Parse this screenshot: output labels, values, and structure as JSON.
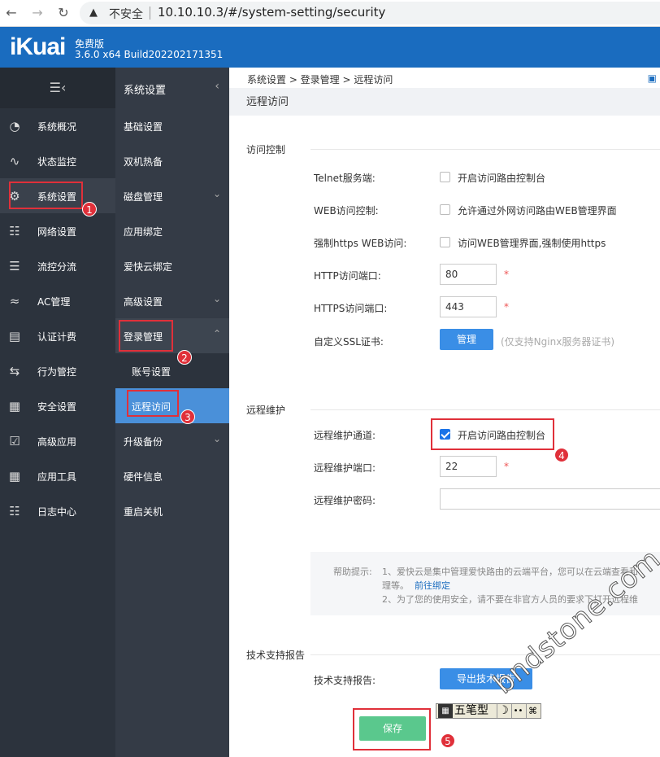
{
  "browser": {
    "back_icon": "arrow-left-icon",
    "forward_icon": "arrow-right-icon",
    "reload_icon": "reload-icon",
    "not_secure": "不安全",
    "url": "10.10.10.3/#/system-setting/security"
  },
  "header": {
    "logo": "iKuai",
    "edition": "免费版",
    "build": "3.6.0 x64 Build202202171351",
    "brand_color": "#1a6cbf"
  },
  "sidebar": {
    "collapse_icon": "menu-collapse-icon",
    "items": [
      {
        "label": "系统概况",
        "icon": "gauge-icon"
      },
      {
        "label": "状态监控",
        "icon": "pulse-icon"
      },
      {
        "label": "系统设置",
        "icon": "gear-icon"
      },
      {
        "label": "网络设置",
        "icon": "network-icon"
      },
      {
        "label": "流控分流",
        "icon": "sliders-icon"
      },
      {
        "label": "AC管理",
        "icon": "wifi-icon"
      },
      {
        "label": "认证计费",
        "icon": "id-card-icon"
      },
      {
        "label": "行为管控",
        "icon": "swap-icon"
      },
      {
        "label": "安全设置",
        "icon": "firewall-icon"
      },
      {
        "label": "高级应用",
        "icon": "checklist-icon"
      },
      {
        "label": "应用工具",
        "icon": "apps-icon"
      },
      {
        "label": "日志中心",
        "icon": "log-icon"
      }
    ]
  },
  "submenu": {
    "title": "系统设置",
    "items": [
      {
        "label": "基础设置"
      },
      {
        "label": "双机热备"
      },
      {
        "label": "磁盘管理"
      },
      {
        "label": "应用绑定"
      },
      {
        "label": "爱快云绑定"
      },
      {
        "label": "高级设置"
      },
      {
        "label": "登录管理"
      },
      {
        "label": "账号设置"
      },
      {
        "label": "远程访问"
      },
      {
        "label": "升级备份"
      },
      {
        "label": "硬件信息"
      },
      {
        "label": "重启关机"
      }
    ]
  },
  "main": {
    "breadcrumb": "系统设置 > 登录管理 > 远程访问",
    "page_title": "远程访问",
    "access_control": {
      "section": "访问控制",
      "telnet_label": "Telnet服务端:",
      "telnet_option": "开启访问路由控制台",
      "web_label": "WEB访问控制:",
      "web_option": "允许通过外网访问路由WEB管理界面",
      "https_label": "强制https WEB访问:",
      "https_option": "访问WEB管理界面,强制使用https",
      "http_port_label": "HTTP访问端口:",
      "http_port": "80",
      "https_port_label": "HTTPS访问端口:",
      "https_port": "443",
      "ssl_label": "自定义SSL证书:",
      "ssl_button": "管理",
      "ssl_hint": "(仅支持Nginx服务器证书)",
      "required_mark": "*"
    },
    "remote": {
      "section": "远程维护",
      "channel_label": "远程维护通道:",
      "channel_option": "开启访问路由控制台",
      "channel_checked": true,
      "port_label": "远程维护端口:",
      "port": "22",
      "password_label": "远程维护密码:",
      "password": ""
    },
    "help": {
      "prefix": "帮助提示:",
      "line1": "1、爱快云是集中管理爱快路由的云端平台，您可以在云端查看和",
      "line1b": "理等。",
      "link": "前往绑定",
      "line2": "2、为了您的使用安全，请不要在非官方人员的要求下打开远程维"
    },
    "support": {
      "section": "技术支持报告",
      "label": "技术支持报告:",
      "button": "导出技术报告"
    },
    "save_button": "保存"
  },
  "annotations": [
    "1",
    "2",
    "3",
    "4",
    "5"
  ],
  "ime": {
    "label": "五笔型",
    "moon": "☽",
    "dots": "••",
    "rest": "⌘"
  },
  "watermark": "bndstone.com"
}
